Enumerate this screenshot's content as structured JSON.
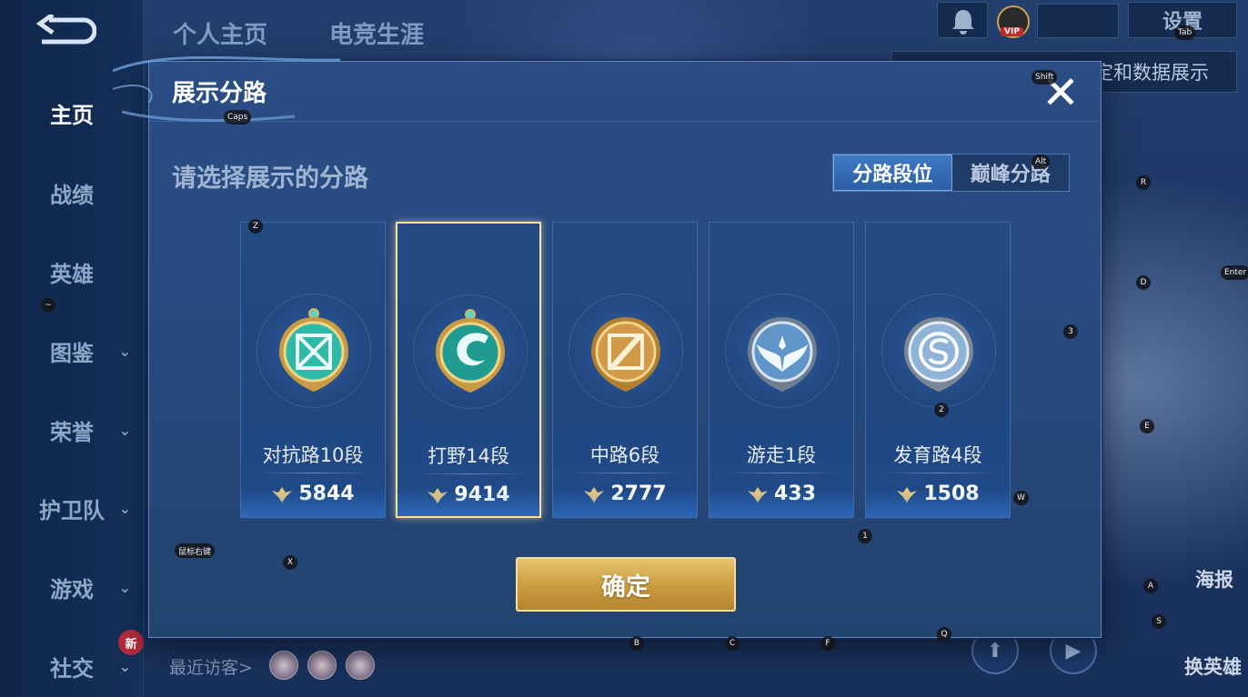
{
  "sidebar": {
    "back_label": "",
    "items": [
      {
        "label": "主页",
        "active": true
      },
      {
        "label": "战绩",
        "active": false
      },
      {
        "label": "英雄",
        "active": false
      },
      {
        "label": "图鉴",
        "active": false,
        "expandable": true
      },
      {
        "label": "荣誉",
        "active": false,
        "expandable": true
      },
      {
        "label": "护卫队",
        "active": false,
        "expandable": true
      },
      {
        "label": "游戏",
        "active": false,
        "expandable": true
      },
      {
        "label": "社交",
        "active": false,
        "expandable": true
      }
    ],
    "new_badge": "新"
  },
  "top_tabs": [
    "个人主页",
    "电竞生涯"
  ],
  "topbar": {
    "vip_label": "VIP",
    "settings_label": "设置",
    "banner_text": "定和数据展示"
  },
  "footer": {
    "recent_visitors_label": "最近访客>"
  },
  "right_panel": {
    "poster_label": "海报",
    "switch_hero_label": "换英雄"
  },
  "modal": {
    "title": "展示分路",
    "close_symbol": "✕",
    "subtitle": "请选择展示的分路",
    "toggle": [
      "分路段位",
      "巅峰分路"
    ],
    "toggle_active_index": 0,
    "cards": [
      {
        "label": "对抗路10段",
        "points": "5844",
        "emblem": "sword-cross-emblem",
        "selected": false
      },
      {
        "label": "打野14段",
        "points": "9414",
        "emblem": "dragon-emblem",
        "selected": true
      },
      {
        "label": "中路6段",
        "points": "2777",
        "emblem": "slash-emblem",
        "selected": false
      },
      {
        "label": "游走1段",
        "points": "433",
        "emblem": "wings-emblem",
        "selected": false
      },
      {
        "label": "发育路4段",
        "points": "1508",
        "emblem": "shield-s-emblem",
        "selected": false
      }
    ],
    "confirm_label": "确定"
  },
  "key_hints": [
    "Tab",
    "Shift",
    "Caps",
    "Alt",
    "R",
    "Z",
    "Enter",
    "D",
    "~",
    "3",
    "2",
    "E",
    "W",
    "1",
    "鼠标右键",
    "X",
    "A",
    "S",
    "B",
    "C",
    "F",
    "Q"
  ],
  "colors": {
    "accent_gold": "#e6c46e",
    "selected_border": "#f6dfa0",
    "toggle_active": "#3f79c4",
    "panel_bg": "#2a4d83"
  }
}
